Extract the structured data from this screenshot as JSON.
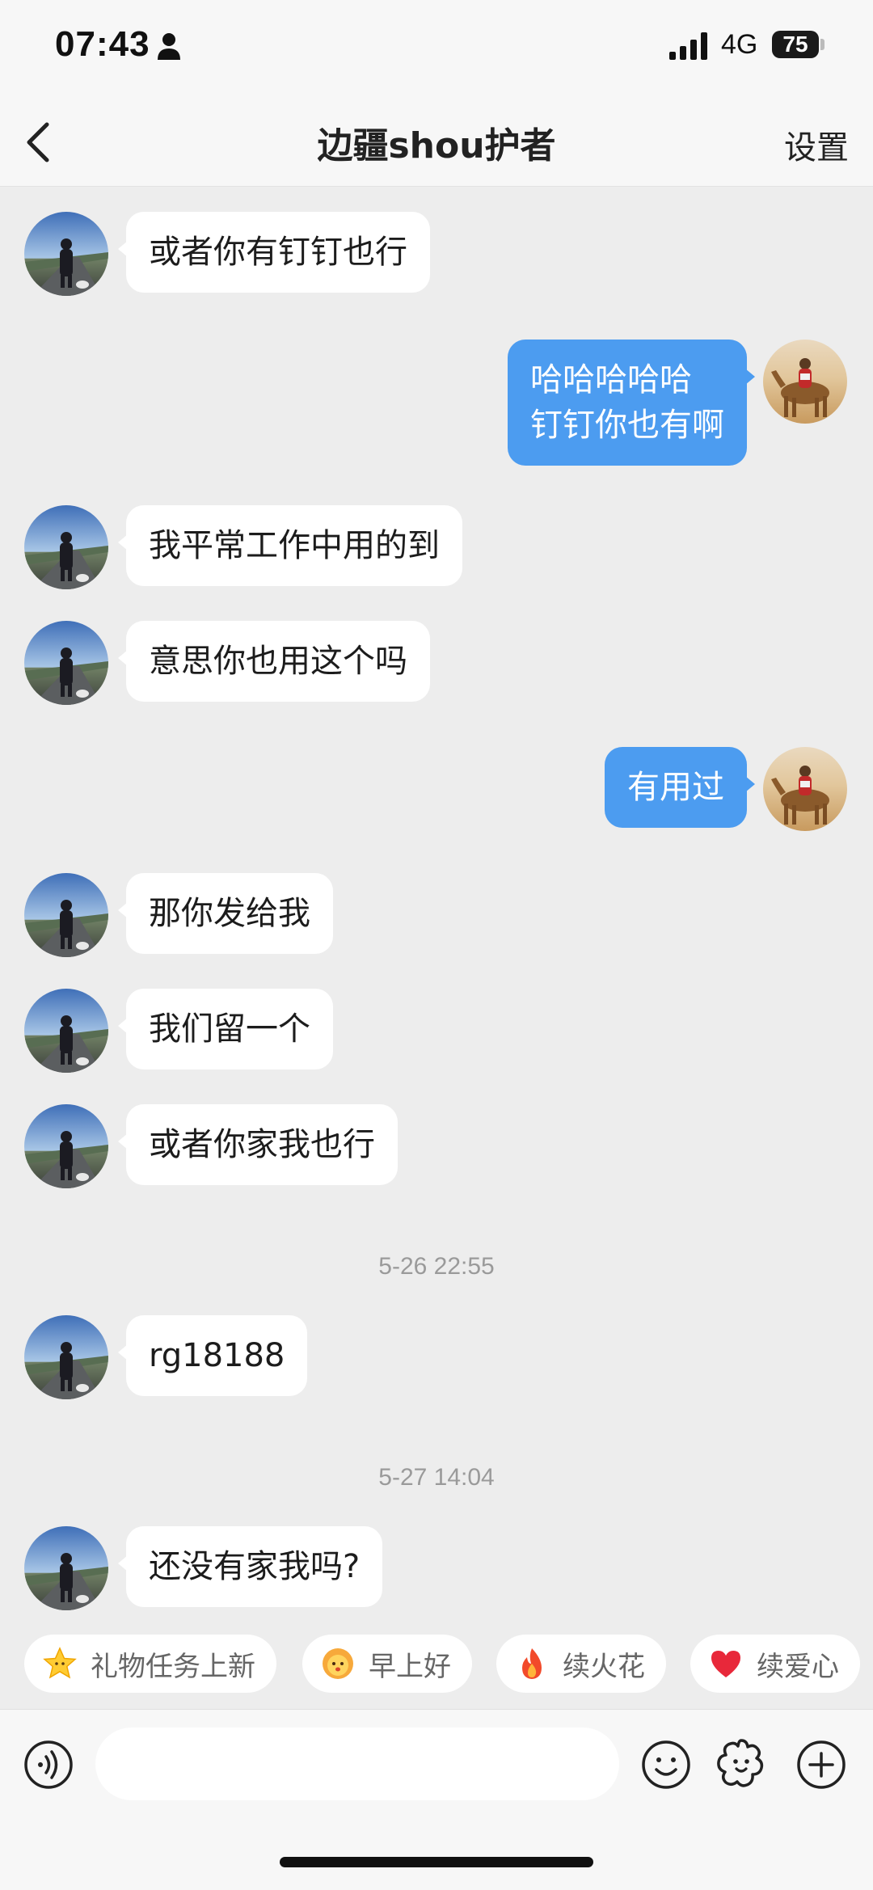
{
  "status_bar": {
    "time": "07:43",
    "network": "4G",
    "battery": "75"
  },
  "nav": {
    "title": "边疆shou护者",
    "settings_label": "设置"
  },
  "messages": [
    {
      "side": "in",
      "text": "或者你有钉钉也行"
    },
    {
      "side": "out",
      "lines": [
        "哈哈哈哈哈",
        "钉钉你也有啊"
      ]
    },
    {
      "side": "in",
      "text": "我平常工作中用的到"
    },
    {
      "side": "in",
      "text": "意思你也用这个吗"
    },
    {
      "side": "out",
      "text": "有用过"
    },
    {
      "side": "in",
      "text": "那你发给我"
    },
    {
      "side": "in",
      "text": "我们留一个"
    },
    {
      "side": "in",
      "text": "或者你家我也行"
    },
    {
      "type": "timestamp",
      "text": "5-26 22:55"
    },
    {
      "side": "in",
      "text": "rg18188"
    },
    {
      "type": "timestamp",
      "text": "5-27 14:04"
    },
    {
      "side": "in",
      "text": "还没有家我吗?"
    }
  ],
  "quick_replies": [
    {
      "label": "礼物任务上新",
      "icon": "star-face-icon"
    },
    {
      "label": "早上好",
      "icon": "sun-face-icon"
    },
    {
      "label": "续火花",
      "icon": "fire-icon"
    },
    {
      "label": "续爱心",
      "icon": "heart-icon"
    }
  ],
  "composer": {
    "input_value": ""
  },
  "colors": {
    "outgoing_bubble": "#4c9cf0",
    "incoming_bubble": "#ffffff",
    "background": "#ededed"
  }
}
